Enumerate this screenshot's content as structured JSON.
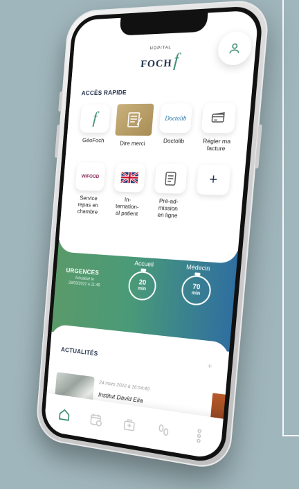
{
  "app": {
    "logo_small": "HOPITAL",
    "logo_word": "FOCH",
    "logo_mark": "f"
  },
  "quick_access": {
    "title": "ACCÈS RAPIDE",
    "items": [
      {
        "label": "GéoFoch",
        "icon": "foch-f-icon"
      },
      {
        "label": "Dire merci",
        "icon": "notepad-pen-icon"
      },
      {
        "label": "Doctolib",
        "icon": "doctolib-logo-icon",
        "icon_text": "Doctolib"
      },
      {
        "label": "Régler ma\nfacture",
        "icon": "credit-card-icon"
      },
      {
        "label": "Service\nrepas en\nchambre",
        "icon": "wifood-logo-icon",
        "icon_text": "WiFOOD"
      },
      {
        "label": "In-\nternation-\nal patient",
        "icon": "uk-flag-icon"
      },
      {
        "label": "Pré-ad-\nmission\nen ligne",
        "icon": "document-icon"
      },
      {
        "label": "",
        "icon": "plus-icon",
        "icon_text": "+"
      }
    ]
  },
  "urgences": {
    "title": "URGENCES",
    "updated": "Actualisé le\n28/03/2022 à 11:45",
    "accueil": {
      "label": "Accueil",
      "value": "20",
      "unit": "min"
    },
    "medecin": {
      "label": "Médecin",
      "value": "70",
      "unit": "min"
    }
  },
  "news": {
    "title": "ACTUALITÉS",
    "plus": "+",
    "item": {
      "date": "24 mars 2022 à 16:54:40",
      "headline": "Institut David Elia"
    }
  },
  "nav": [
    "home-icon",
    "calendar-icon",
    "medical-bag-icon",
    "footprints-icon",
    "more-dots-icon"
  ],
  "colors": {
    "brand_green": "#3a8a70",
    "navy": "#1f2f4a",
    "gradient_start": "#5a9a6a",
    "gradient_end": "#2f6fa0",
    "gold": "#c9b07c"
  }
}
